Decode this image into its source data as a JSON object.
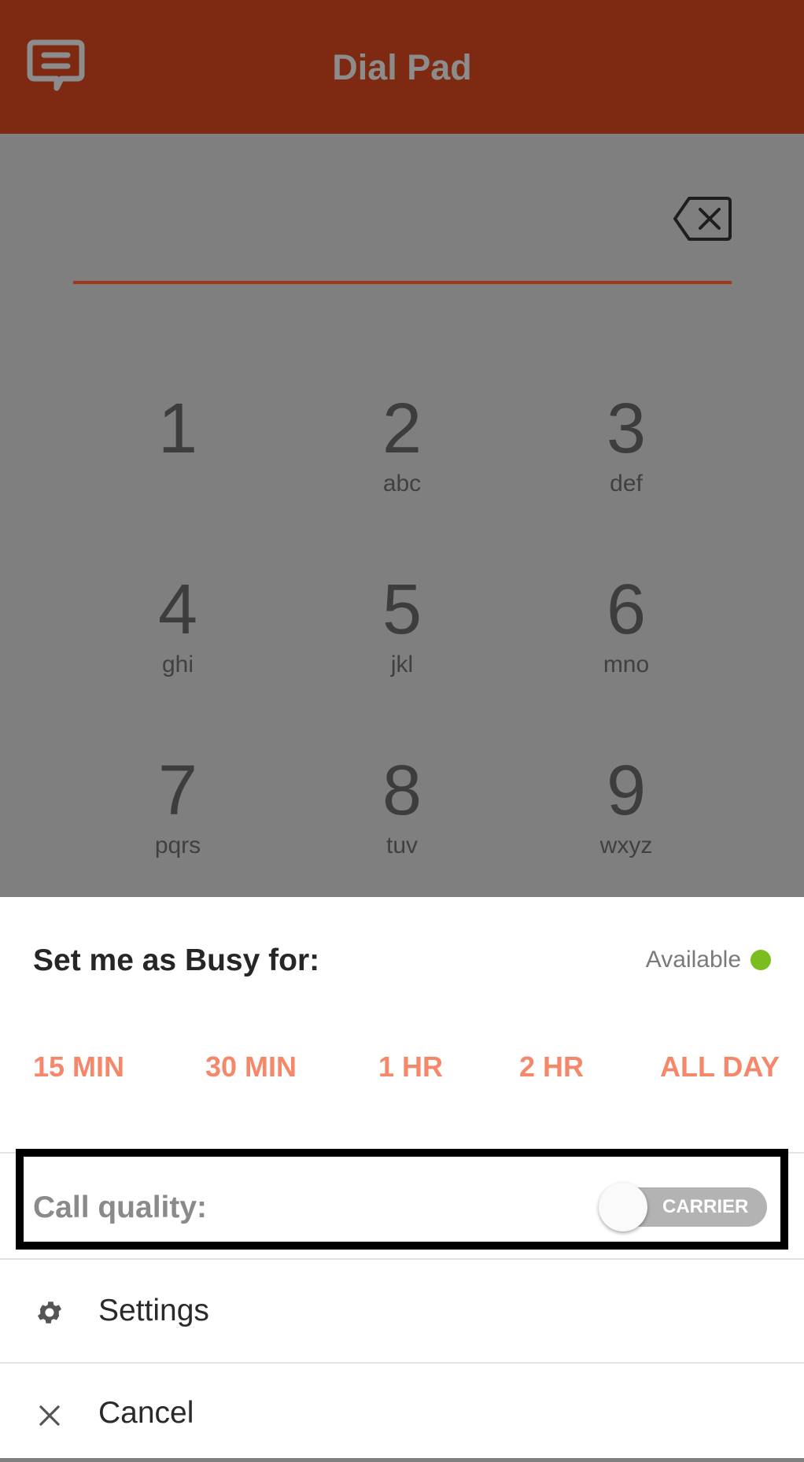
{
  "header": {
    "title": "Dial Pad",
    "logo_icon": "chat-bubble-logo-icon"
  },
  "dialer": {
    "backspace_icon": "backspace-icon",
    "keys": [
      {
        "digit": "1",
        "letters": ""
      },
      {
        "digit": "2",
        "letters": "abc"
      },
      {
        "digit": "3",
        "letters": "def"
      },
      {
        "digit": "4",
        "letters": "ghi"
      },
      {
        "digit": "5",
        "letters": "jkl"
      },
      {
        "digit": "6",
        "letters": "mno"
      },
      {
        "digit": "7",
        "letters": "pqrs"
      },
      {
        "digit": "8",
        "letters": "tuv"
      },
      {
        "digit": "9",
        "letters": "wxyz"
      }
    ]
  },
  "busy_sheet": {
    "title": "Set me as Busy for:",
    "status_label": "Available",
    "status_color": "#7bbd1e",
    "durations": [
      "15 MIN",
      "30 MIN",
      "1 HR",
      "2 HR",
      "ALL DAY"
    ]
  },
  "call_quality": {
    "label": "Call quality:",
    "toggle_label": "CARRIER",
    "toggle_on": false
  },
  "menu": {
    "settings_label": "Settings",
    "cancel_label": "Cancel"
  },
  "colors": {
    "header_bg": "#7e2a12",
    "accent_line": "#a2381a",
    "duration_text": "#f5876a"
  }
}
